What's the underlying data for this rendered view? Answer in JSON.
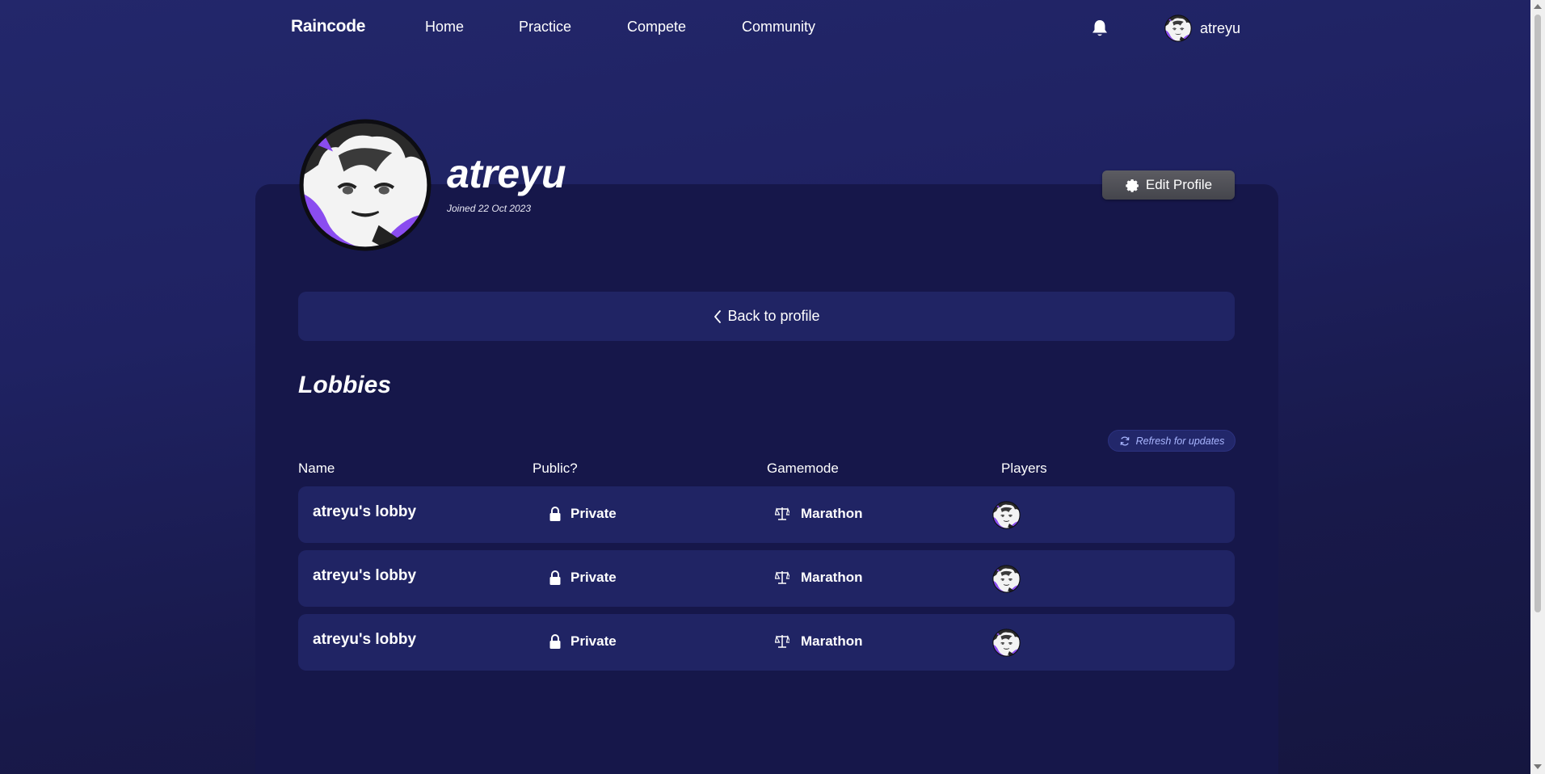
{
  "nav": {
    "brand": "Raincode",
    "links": [
      "Home",
      "Practice",
      "Compete",
      "Community"
    ],
    "username": "atreyu"
  },
  "profile": {
    "name": "atreyu",
    "joined": "Joined 22 Oct 2023",
    "edit_label": "Edit Profile",
    "back_label": "Back to profile"
  },
  "lobbies": {
    "title": "Lobbies",
    "refresh_label": "Refresh for updates",
    "columns": [
      "Name",
      "Public?",
      "Gamemode",
      "Players"
    ],
    "rows": [
      {
        "name": "atreyu's lobby",
        "visibility": "Private",
        "gamemode": "Marathon",
        "players": [
          "atreyu-avatar"
        ]
      },
      {
        "name": "atreyu's lobby",
        "visibility": "Private",
        "gamemode": "Marathon",
        "players": [
          "atreyu-avatar"
        ]
      },
      {
        "name": "atreyu's lobby",
        "visibility": "Private",
        "gamemode": "Marathon",
        "players": [
          "atreyu-avatar"
        ]
      }
    ]
  },
  "icons": {
    "notifications": "bell-icon",
    "settings": "gear-icon",
    "back": "chevron-left-icon",
    "refresh": "refresh-icon",
    "private": "lock-icon",
    "gamemode": "scales-icon"
  },
  "colors": {
    "background": "#1f2262",
    "panel": "#16174a",
    "row": "#202464",
    "accent_purple": "#8a4cf0",
    "refresh_text": "#a9b6ff",
    "edit_button": "#4e4f56"
  }
}
